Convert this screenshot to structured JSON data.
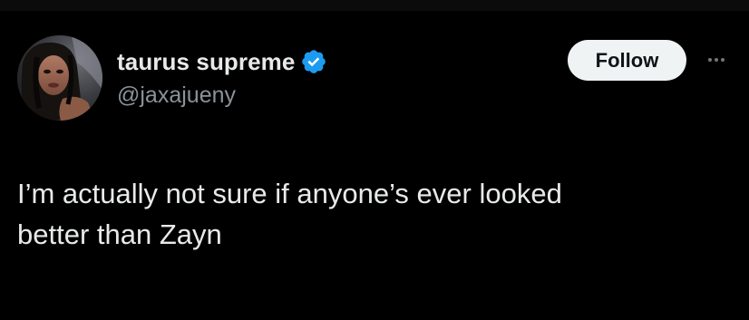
{
  "author": {
    "display_name": "taurus supreme",
    "handle": "@jaxajueny",
    "verified": true,
    "verified_color": "#1d9bf0",
    "avatar_icon": "profile-photo"
  },
  "actions": {
    "follow_label": "Follow",
    "more_icon": "more-options-icon"
  },
  "tweet": {
    "text": "I’m actually not sure if anyone’s ever looked\nbetter than Zayn"
  },
  "colors": {
    "background": "#000000",
    "text_primary": "#e7e9ea",
    "text_secondary": "#8b9298",
    "follow_button_bg": "#eff3f4"
  }
}
